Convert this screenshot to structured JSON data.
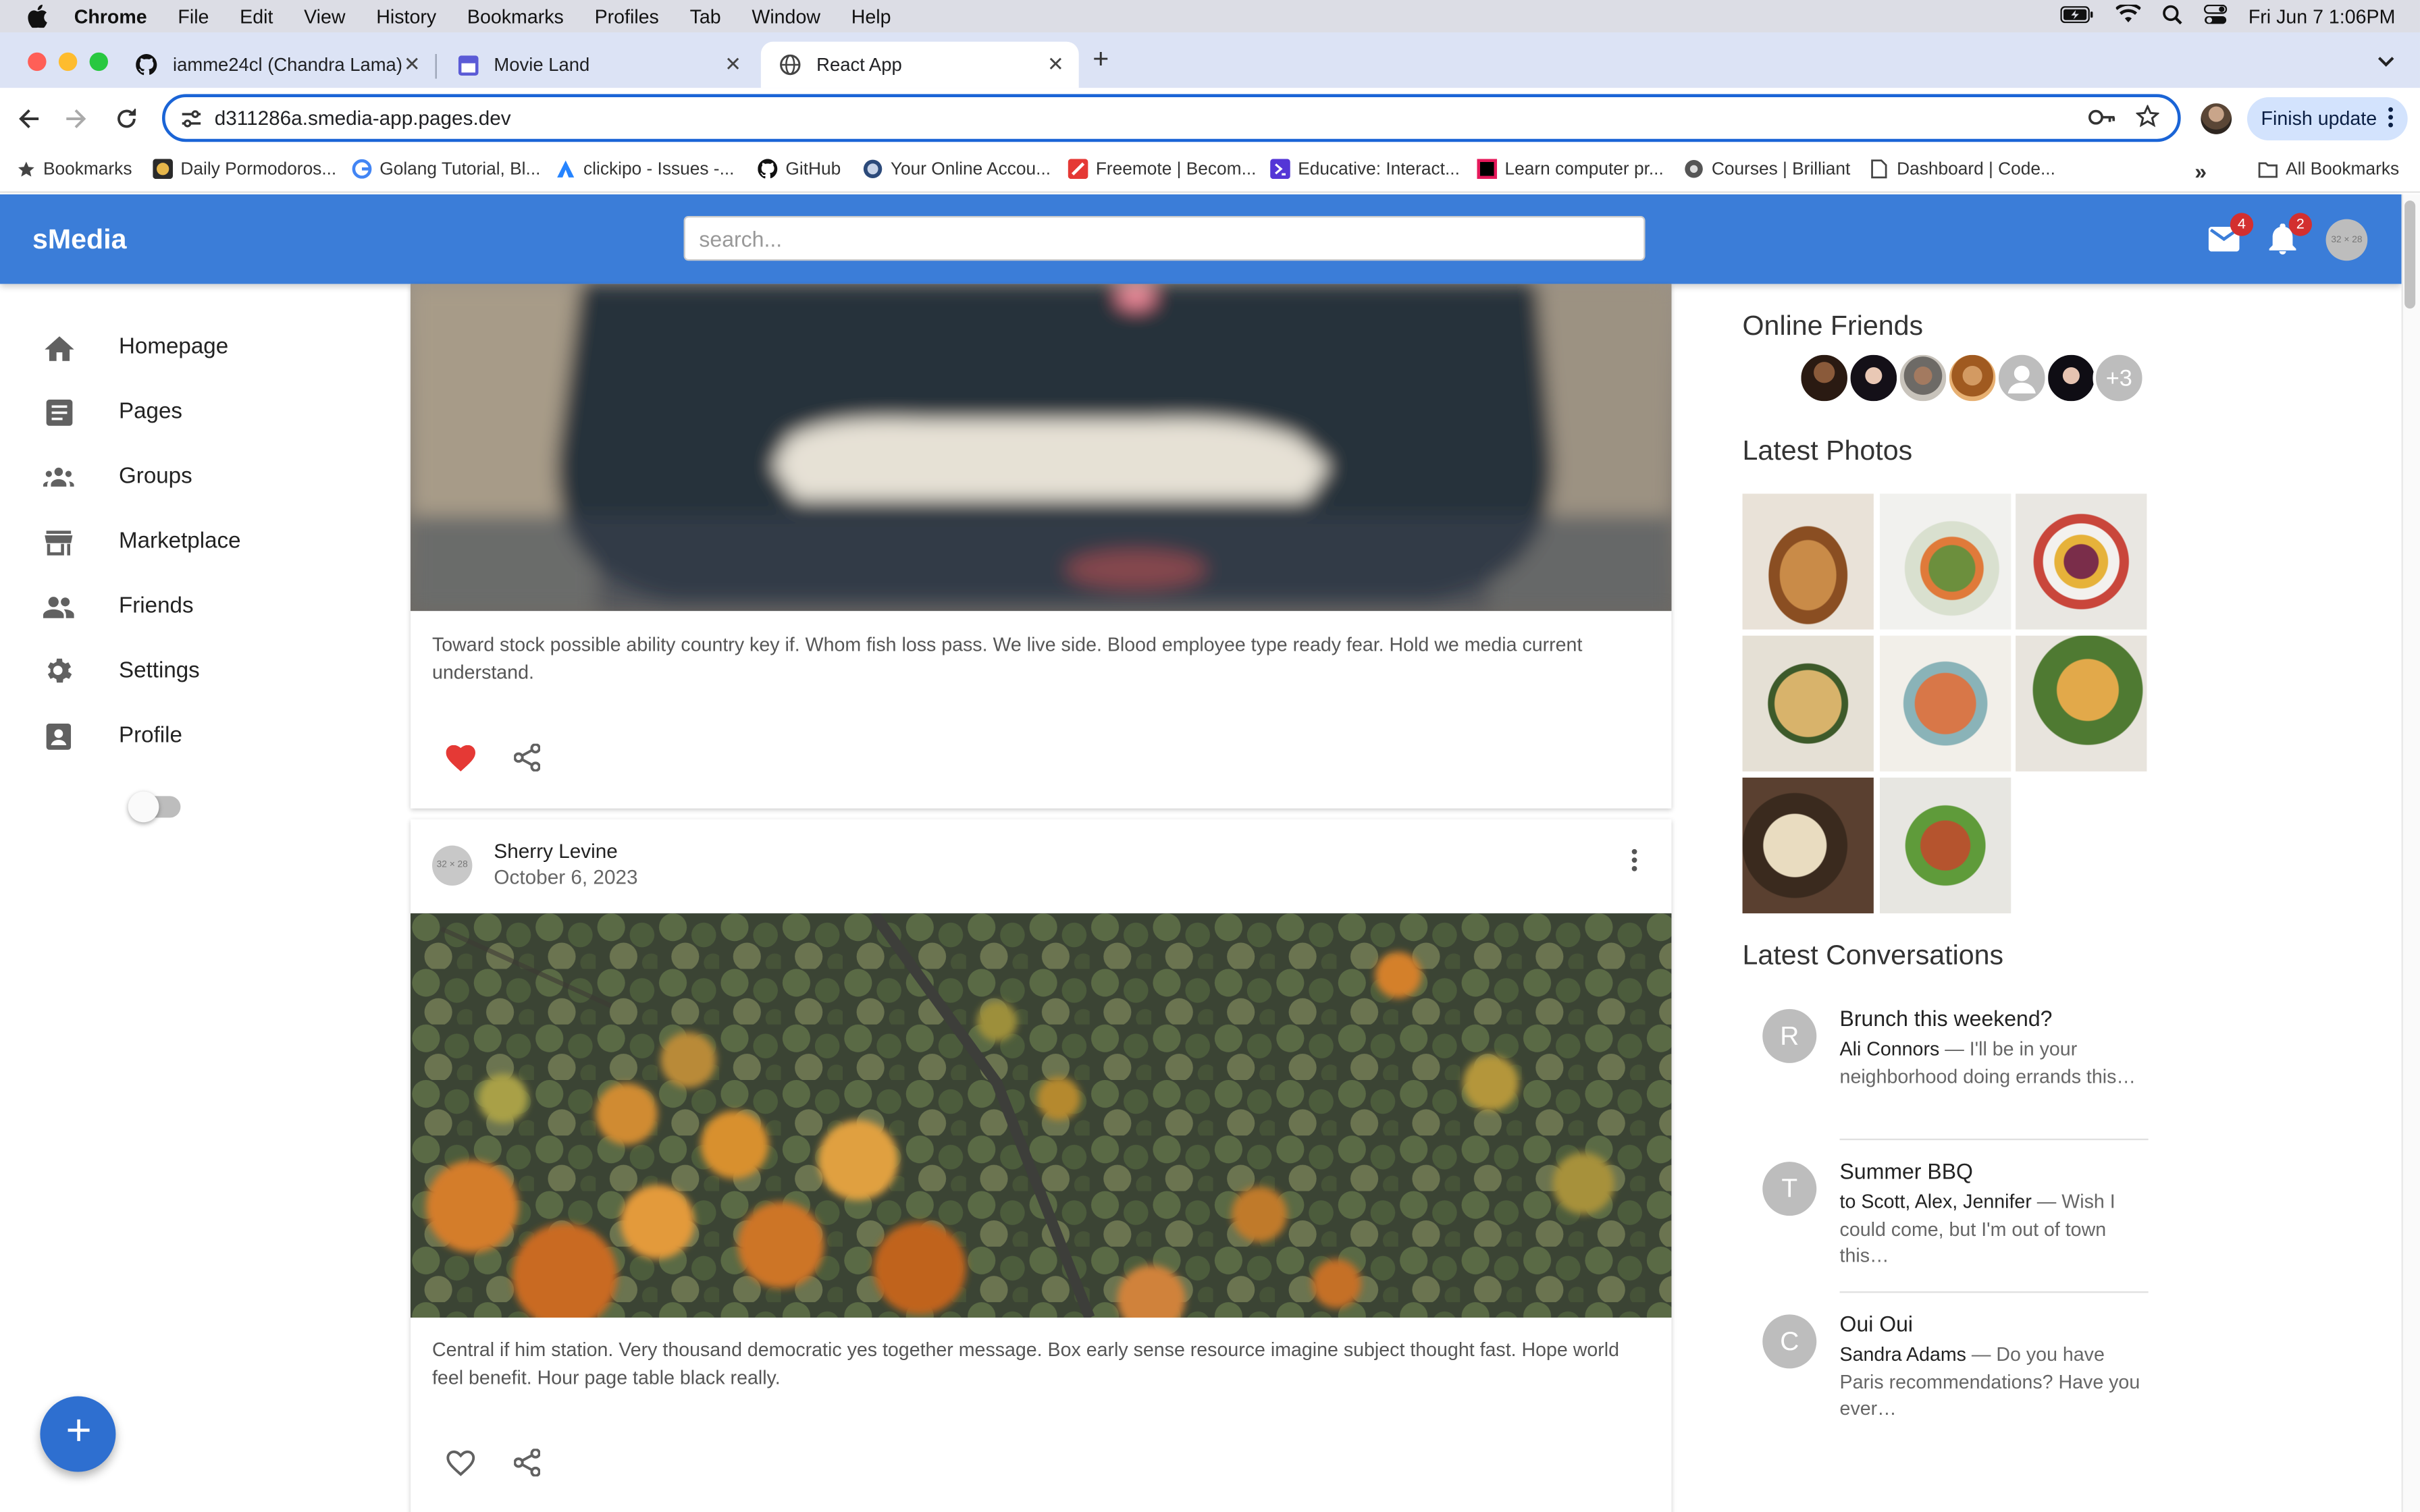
{
  "menubar": {
    "app": "Chrome",
    "items": [
      "File",
      "Edit",
      "View",
      "History",
      "Bookmarks",
      "Profiles",
      "Tab",
      "Window",
      "Help"
    ],
    "datetime": "Fri Jun 7  1:06PM"
  },
  "tabs": [
    {
      "title": "iamme24cl (Chandra Lama)",
      "icon": "github-icon"
    },
    {
      "title": "Movie Land",
      "icon": "page-icon"
    },
    {
      "title": "React App",
      "icon": "globe-icon",
      "active": true
    }
  ],
  "toolbar": {
    "url": "d311286a.smedia-app.pages.dev",
    "finish_update": "Finish update"
  },
  "bookmarks": {
    "label": "Bookmarks",
    "items": [
      "Daily Pormodoros...",
      "Golang Tutorial, Bl...",
      "clickipo - Issues -...",
      "GitHub",
      "Your Online Accou...",
      "Freemote | Becom...",
      "Educative: Interact...",
      "Learn computer pr...",
      "Courses | Brilliant",
      "Dashboard | Code..."
    ],
    "all": "All Bookmarks"
  },
  "app": {
    "logo": "sMedia",
    "search_placeholder": "search...",
    "mail_count": "4",
    "notif_count": "2",
    "avatar_text": "32 × 28"
  },
  "sidebar": {
    "items": [
      {
        "label": "Homepage",
        "icon": "home-icon"
      },
      {
        "label": "Pages",
        "icon": "article-icon"
      },
      {
        "label": "Groups",
        "icon": "groups-icon"
      },
      {
        "label": "Marketplace",
        "icon": "storefront-icon"
      },
      {
        "label": "Friends",
        "icon": "people-icon"
      },
      {
        "label": "Settings",
        "icon": "gear-icon"
      },
      {
        "label": "Profile",
        "icon": "profile-icon"
      }
    ],
    "dark_mode": false
  },
  "feed": {
    "post1": {
      "text": "Toward stock possible ability country key if. Whom fish loss pass. We live side. Blood employee type ready fear. Hold we media current understand.",
      "liked": true
    },
    "post2": {
      "author": "Sherry Levine",
      "date": "October 6, 2023",
      "avatar_text": "32 × 28",
      "text": "Central if him station. Very thousand democratic yes together message. Box early sense resource imagine subject thought fast. Hope world feel benefit. Hour page table black really.",
      "liked": false
    }
  },
  "right": {
    "online_title": "Online Friends",
    "more_friends": "+3",
    "photos_title": "Latest Photos",
    "conversations_title": "Latest Conversations",
    "conversations": [
      {
        "initial": "R",
        "title": "Brunch this weekend?",
        "from": "Ali Connors",
        "snippet": " — I'll be in your neighborhood doing errands this…"
      },
      {
        "initial": "T",
        "title": "Summer BBQ",
        "from": "to Scott, Alex, Jennifer",
        "snippet": " — Wish I could come, but I'm out of town this…"
      },
      {
        "initial": "C",
        "title": "Oui Oui",
        "from": "Sandra Adams",
        "snippet": " — Do you have Paris recommendations? Have you ever…"
      }
    ]
  },
  "colors": {
    "appbar": "#3b7dd8",
    "fab": "#2e6fd0",
    "like": "#e53935",
    "badge": "#d32f2f"
  }
}
